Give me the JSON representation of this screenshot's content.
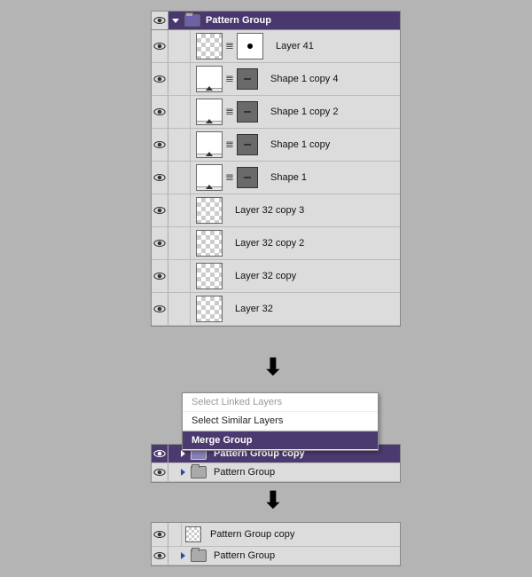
{
  "panel1": {
    "group_name": "Pattern Group",
    "layers": [
      {
        "name": "Layer 41",
        "type": "dot"
      },
      {
        "name": "Shape 1 copy 4",
        "type": "shape"
      },
      {
        "name": "Shape 1 copy 2",
        "type": "shape"
      },
      {
        "name": "Shape 1 copy",
        "type": "shape"
      },
      {
        "name": "Shape 1",
        "type": "shape"
      },
      {
        "name": "Layer 32 copy 3",
        "type": "plain"
      },
      {
        "name": "Layer 32 copy 2",
        "type": "plain"
      },
      {
        "name": "Layer 32 copy",
        "type": "plain"
      },
      {
        "name": "Layer 32",
        "type": "plain"
      }
    ]
  },
  "context_menu": {
    "item1": "Select Linked Layers",
    "item2": "Select Similar Layers",
    "item3": "Merge Group"
  },
  "panel2": {
    "group_selected": "Pattern Group copy",
    "group_normal": "Pattern Group"
  },
  "panel3": {
    "layer1": "Pattern Group copy",
    "group": "Pattern Group"
  }
}
